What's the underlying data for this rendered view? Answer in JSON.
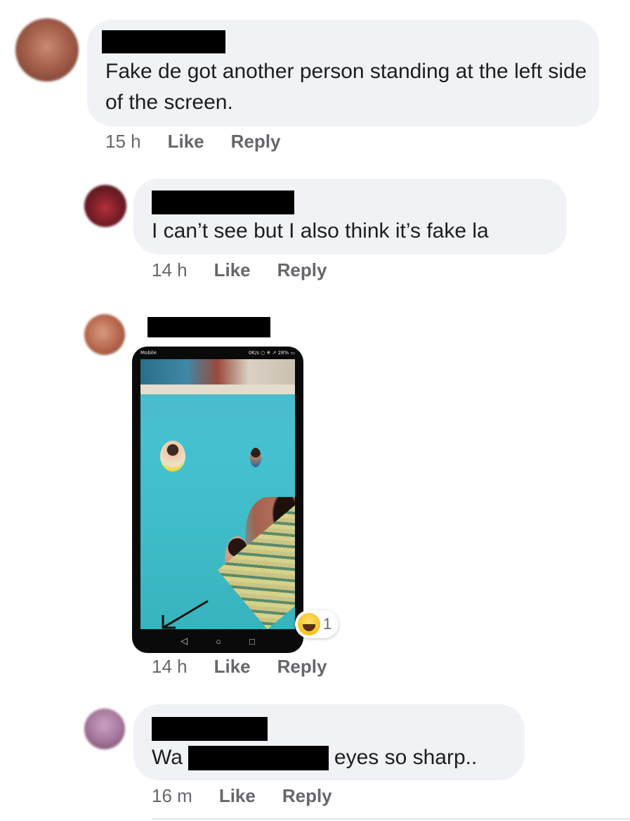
{
  "comments": [
    {
      "text": "Fake de got another person standing at the left side of the screen.",
      "time": "15 h",
      "like_label": "Like",
      "reply_label": "Reply"
    },
    {
      "text": "I can’t see but I also think it’s fake la",
      "time": "14 h",
      "like_label": "Like",
      "reply_label": "Reply"
    },
    {
      "image": {
        "status_left": "Mobile",
        "status_right": "0K/s ○ ✵ ↗ 28% ▭"
      },
      "reaction": {
        "icon": "haha-reaction-icon",
        "count": "1"
      },
      "time": "14 h",
      "like_label": "Like",
      "reply_label": "Reply"
    },
    {
      "text_before": "Wa",
      "text_after": "eyes so sharp..",
      "time": "16 m",
      "like_label": "Like",
      "reply_label": "Reply"
    }
  ],
  "colors": {
    "bubble": "#f0f2f5",
    "meta_text": "#65676b",
    "body_text": "#1c1e21"
  }
}
